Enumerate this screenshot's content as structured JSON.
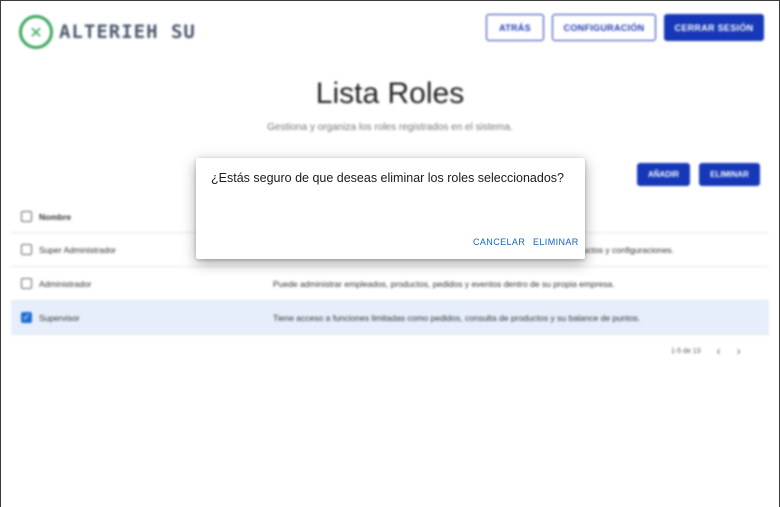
{
  "header": {
    "logo_text": "ALTERIEH SU",
    "logo_icon": "x-logo-icon",
    "buttons": {
      "back": "ATRÁS",
      "config": "CONFIGURACIÓN",
      "logout": "CERRAR SESIÓN"
    }
  },
  "page": {
    "title": "Lista Roles",
    "subtitle": "Gestiona y organiza los roles registrados en el sistema."
  },
  "actions": {
    "add": "AÑADIR",
    "delete": "ELIMINAR"
  },
  "table": {
    "header": {
      "name": "Nombre"
    },
    "rows": [
      {
        "name": "Super Administrador",
        "description": "ductos y configuraciones.",
        "checked": false
      },
      {
        "name": "Administrador",
        "description": "Puede administrar empleados, productos, pedidos y eventos dentro de su propia empresa.",
        "checked": false
      },
      {
        "name": "Supervisor",
        "description": "Tiene acceso a funciones limitadas como pedidos, consulta de productos y su balance de puntos.",
        "checked": true
      }
    ]
  },
  "pagination": {
    "range": "1-5 de 13"
  },
  "dialog": {
    "message": "¿Estás seguro de que deseas eliminar los roles seleccionados?",
    "cancel": "CANCELAR",
    "confirm": "ELIMINAR"
  },
  "colors": {
    "primary": "#1638b8",
    "logo_green": "#3aa55a",
    "dialog_action": "#1565c0",
    "selected_row": "#e6eefb"
  }
}
